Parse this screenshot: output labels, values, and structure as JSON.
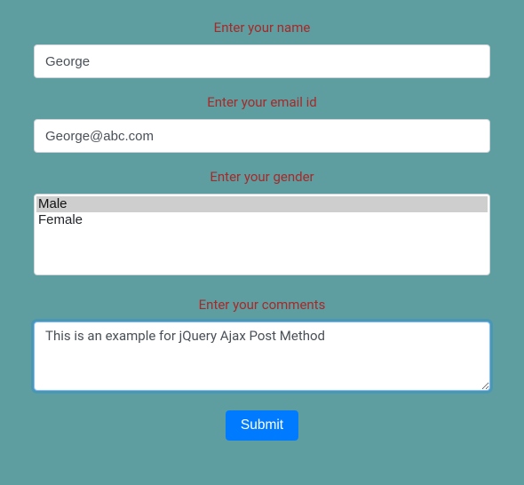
{
  "form": {
    "name": {
      "label": "Enter your name",
      "value": "George"
    },
    "email": {
      "label": "Enter your email id",
      "value": "George@abc.com"
    },
    "gender": {
      "label": "Enter your gender",
      "options": [
        "Male",
        "Female"
      ],
      "selected": "Male"
    },
    "comments": {
      "label": "Enter your comments",
      "value": "This is an example for jQuery Ajax Post Method"
    },
    "submit_label": "Submit"
  }
}
